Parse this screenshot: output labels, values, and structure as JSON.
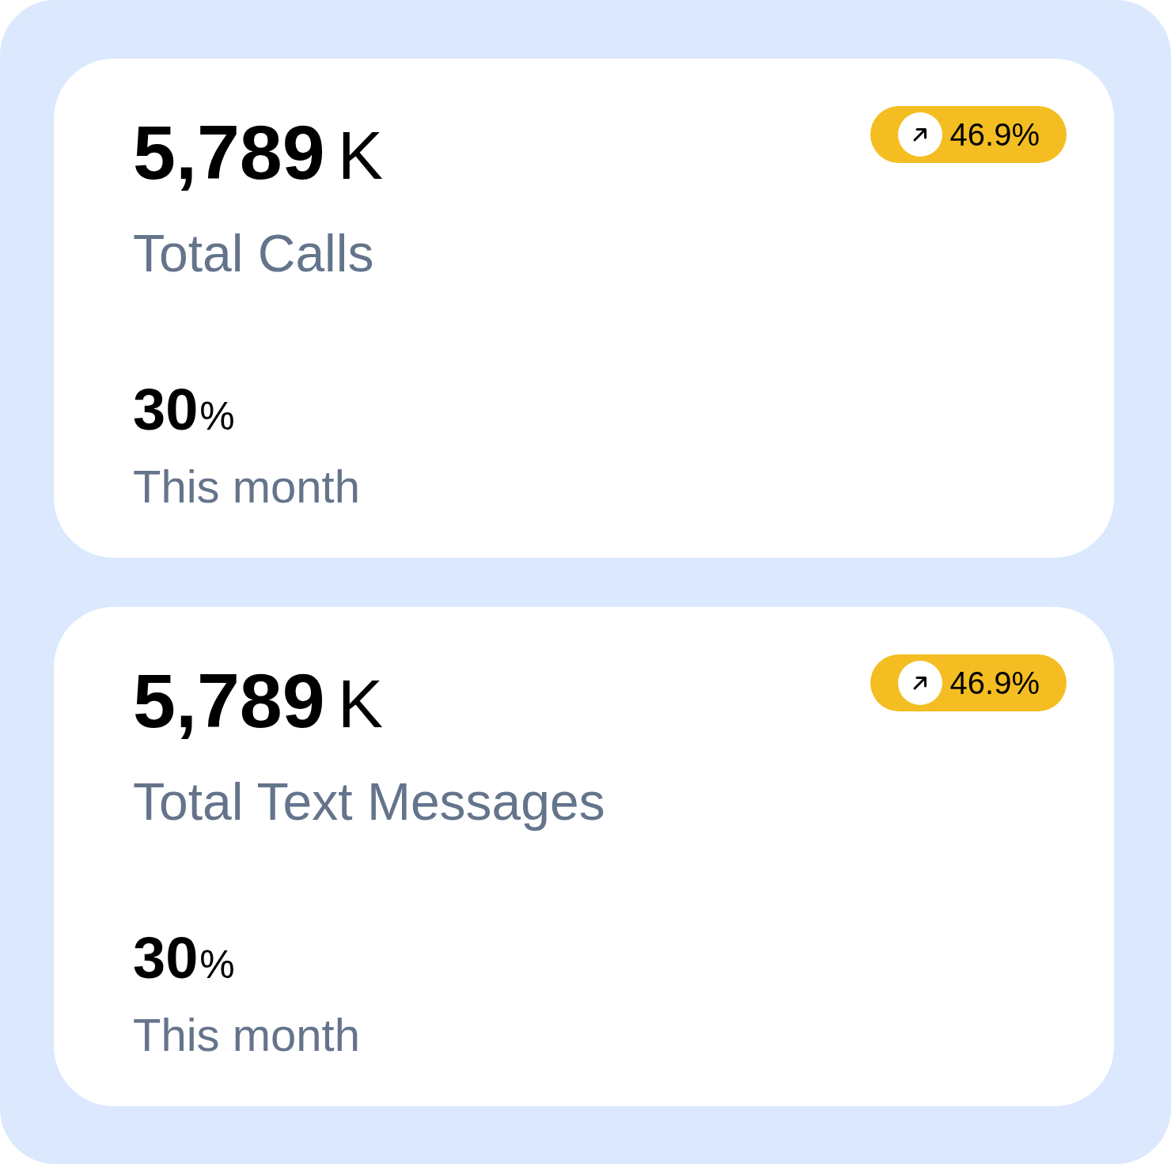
{
  "cards": [
    {
      "value": "5,789",
      "unit": "K",
      "label": "Total Calls",
      "change": "46.9%",
      "percent": "30",
      "percent_unit": "%",
      "period": "This month"
    },
    {
      "value": "5,789",
      "unit": "K",
      "label": "Total Text Messages",
      "change": "46.9%",
      "percent": "30",
      "percent_unit": "%",
      "period": "This month"
    }
  ]
}
